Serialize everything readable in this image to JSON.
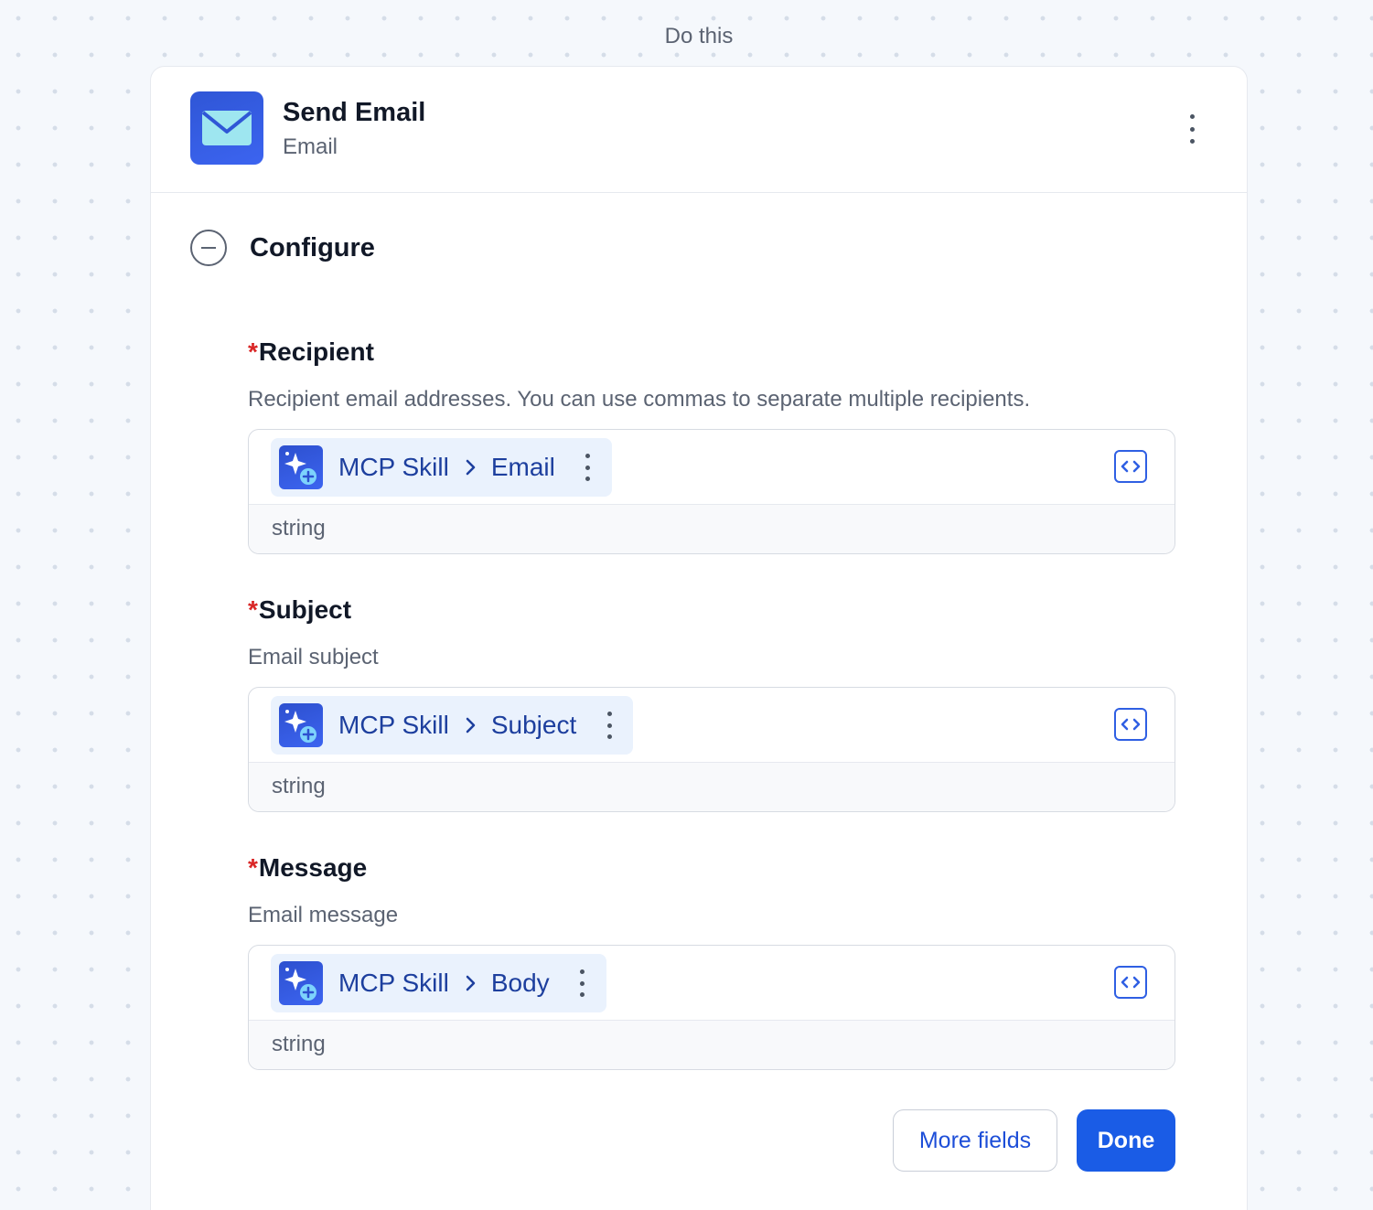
{
  "step_label": "Do this",
  "header": {
    "title": "Send Email",
    "subtitle": "Email"
  },
  "section": {
    "title": "Configure"
  },
  "fields": [
    {
      "required_mark": "*",
      "label": "Recipient",
      "description": "Recipient email addresses. You can use commas to separate multiple recipients.",
      "source": "MCP Skill",
      "value": "Email",
      "type": "string"
    },
    {
      "required_mark": "*",
      "label": "Subject",
      "description": "Email subject",
      "source": "MCP Skill",
      "value": "Subject",
      "type": "string"
    },
    {
      "required_mark": "*",
      "label": "Message",
      "description": "Email message",
      "source": "MCP Skill",
      "value": "Body",
      "type": "string"
    }
  ],
  "buttons": {
    "more_fields": "More fields",
    "done": "Done"
  },
  "colors": {
    "accent": "#1a5ce6",
    "pill_background": "#eaf2fd",
    "required": "#d92626"
  },
  "icons": {
    "app": "envelope-icon",
    "pill": "sparkle-plus-icon",
    "code": "code-brackets-icon"
  }
}
